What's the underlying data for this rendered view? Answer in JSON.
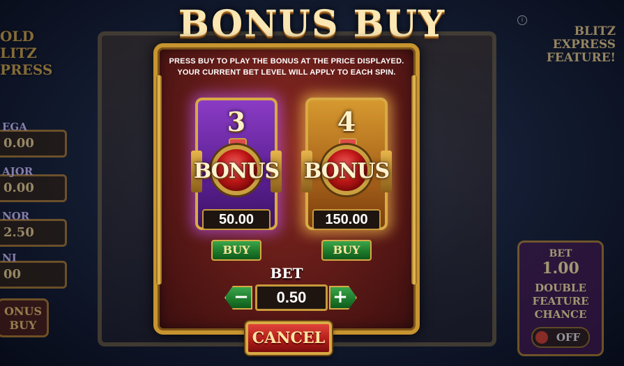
{
  "title": "BONUS BUY",
  "instructions": {
    "line1": "PRESS BUY TO PLAY THE BONUS AT THE PRICE DISPLAYED.",
    "line2": "YOUR CURRENT BET LEVEL WILL APPLY TO EACH SPIN."
  },
  "offers": [
    {
      "spins": "3",
      "label": "BONUS",
      "price": "50.00",
      "buy_label": "BUY",
      "color": "#7a30b8"
    },
    {
      "spins": "4",
      "label": "BONUS",
      "price": "150.00",
      "buy_label": "BUY",
      "color": "#c07a22"
    }
  ],
  "bet": {
    "label": "BET",
    "value": "0.50",
    "decrease_symbol": "−",
    "increase_symbol": "+"
  },
  "cancel_label": "CANCEL",
  "background": {
    "logo_lines": [
      "OLD",
      "LITZ",
      "PRESS"
    ],
    "jackpots": [
      {
        "label": "EGA",
        "value": "0.00"
      },
      {
        "label": "AJOR",
        "value": "0.00"
      },
      {
        "label": "NOR",
        "value": "2.50"
      },
      {
        "label": "NI",
        "value": "00"
      }
    ],
    "bonus_buy_button": "ONUS BUY",
    "blitz_feature": [
      "BLITZ",
      "EXPRESS",
      "FEATURE!"
    ],
    "double_feature": {
      "bet_label": "BET",
      "bet_value": "1.00",
      "text": [
        "DOUBLE",
        "FEATURE",
        "CHANCE"
      ],
      "toggle_state": "OFF"
    }
  },
  "colors": {
    "accent_gold": "#d8aa45",
    "buy_green": "#1e7a2c",
    "cancel_red": "#b31d1a",
    "modal_red": "#5e1a17"
  }
}
